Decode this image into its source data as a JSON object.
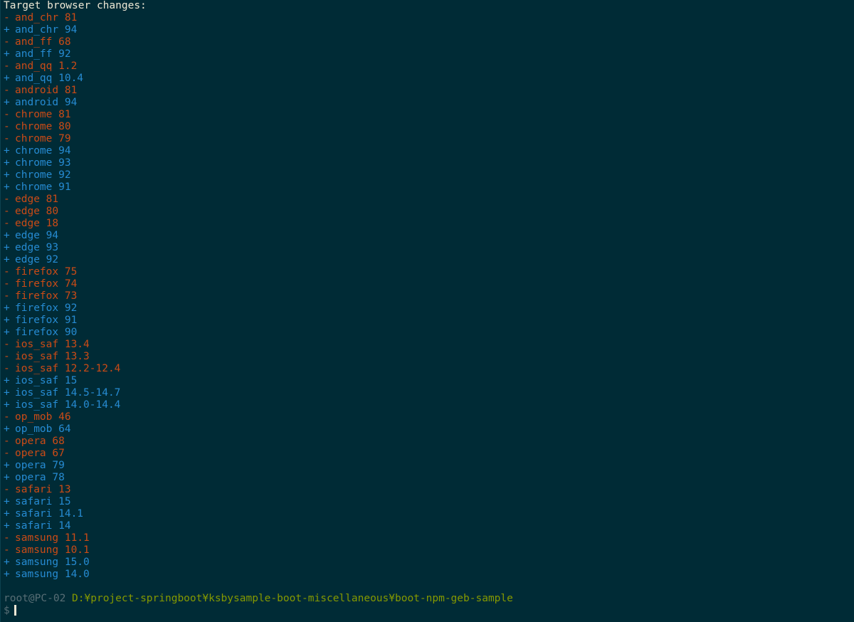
{
  "header": "Target browser changes:",
  "changes": [
    {
      "sign": "-",
      "text": "and_chr 81"
    },
    {
      "sign": "+",
      "text": "and_chr 94"
    },
    {
      "sign": "-",
      "text": "and_ff 68"
    },
    {
      "sign": "+",
      "text": "and_ff 92"
    },
    {
      "sign": "-",
      "text": "and_qq 1.2"
    },
    {
      "sign": "+",
      "text": "and_qq 10.4"
    },
    {
      "sign": "-",
      "text": "android 81"
    },
    {
      "sign": "+",
      "text": "android 94"
    },
    {
      "sign": "-",
      "text": "chrome 81"
    },
    {
      "sign": "-",
      "text": "chrome 80"
    },
    {
      "sign": "-",
      "text": "chrome 79"
    },
    {
      "sign": "+",
      "text": "chrome 94"
    },
    {
      "sign": "+",
      "text": "chrome 93"
    },
    {
      "sign": "+",
      "text": "chrome 92"
    },
    {
      "sign": "+",
      "text": "chrome 91"
    },
    {
      "sign": "-",
      "text": "edge 81"
    },
    {
      "sign": "-",
      "text": "edge 80"
    },
    {
      "sign": "-",
      "text": "edge 18"
    },
    {
      "sign": "+",
      "text": "edge 94"
    },
    {
      "sign": "+",
      "text": "edge 93"
    },
    {
      "sign": "+",
      "text": "edge 92"
    },
    {
      "sign": "-",
      "text": "firefox 75"
    },
    {
      "sign": "-",
      "text": "firefox 74"
    },
    {
      "sign": "-",
      "text": "firefox 73"
    },
    {
      "sign": "+",
      "text": "firefox 92"
    },
    {
      "sign": "+",
      "text": "firefox 91"
    },
    {
      "sign": "+",
      "text": "firefox 90"
    },
    {
      "sign": "-",
      "text": "ios_saf 13.4"
    },
    {
      "sign": "-",
      "text": "ios_saf 13.3"
    },
    {
      "sign": "-",
      "text": "ios_saf 12.2-12.4"
    },
    {
      "sign": "+",
      "text": "ios_saf 15"
    },
    {
      "sign": "+",
      "text": "ios_saf 14.5-14.7"
    },
    {
      "sign": "+",
      "text": "ios_saf 14.0-14.4"
    },
    {
      "sign": "-",
      "text": "op_mob 46"
    },
    {
      "sign": "+",
      "text": "op_mob 64"
    },
    {
      "sign": "-",
      "text": "opera 68"
    },
    {
      "sign": "-",
      "text": "opera 67"
    },
    {
      "sign": "+",
      "text": "opera 79"
    },
    {
      "sign": "+",
      "text": "opera 78"
    },
    {
      "sign": "-",
      "text": "safari 13"
    },
    {
      "sign": "+",
      "text": "safari 15"
    },
    {
      "sign": "+",
      "text": "safari 14.1"
    },
    {
      "sign": "+",
      "text": "safari 14"
    },
    {
      "sign": "-",
      "text": "samsung 11.1"
    },
    {
      "sign": "-",
      "text": "samsung 10.1"
    },
    {
      "sign": "+",
      "text": "samsung 15.0"
    },
    {
      "sign": "+",
      "text": "samsung 14.0"
    }
  ],
  "prompt": {
    "user_host": "root@PC-02",
    "path": "D:¥project-springboot¥ksbysample-boot-miscellaneous¥boot-npm-geb-sample",
    "symbol": "$"
  },
  "colors": {
    "background": "#002b36",
    "removed": "#cb4b16",
    "added": "#268bd2",
    "path": "#859900"
  }
}
